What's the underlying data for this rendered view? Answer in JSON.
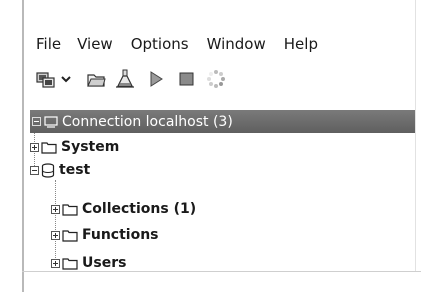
{
  "menu": {
    "items": [
      "File",
      "View",
      "Options",
      "Window",
      "Help"
    ]
  },
  "toolbar": {
    "buttons": [
      {
        "name": "connect-dropdown-icon"
      },
      {
        "name": "chevron-down-icon"
      },
      {
        "name": "open-folder-icon"
      },
      {
        "name": "flask-icon"
      },
      {
        "name": "play-icon"
      },
      {
        "name": "stop-icon"
      },
      {
        "name": "spinner-icon"
      }
    ]
  },
  "tree": {
    "root": "Connection localhost (3)",
    "system": "System",
    "db": "test",
    "collections": "Collections (1)",
    "functions": "Functions",
    "users": "Users"
  },
  "colors": {
    "root_row_background": "#6b6b6b",
    "root_text": "#ffffff",
    "text": "#1a1a1a"
  }
}
